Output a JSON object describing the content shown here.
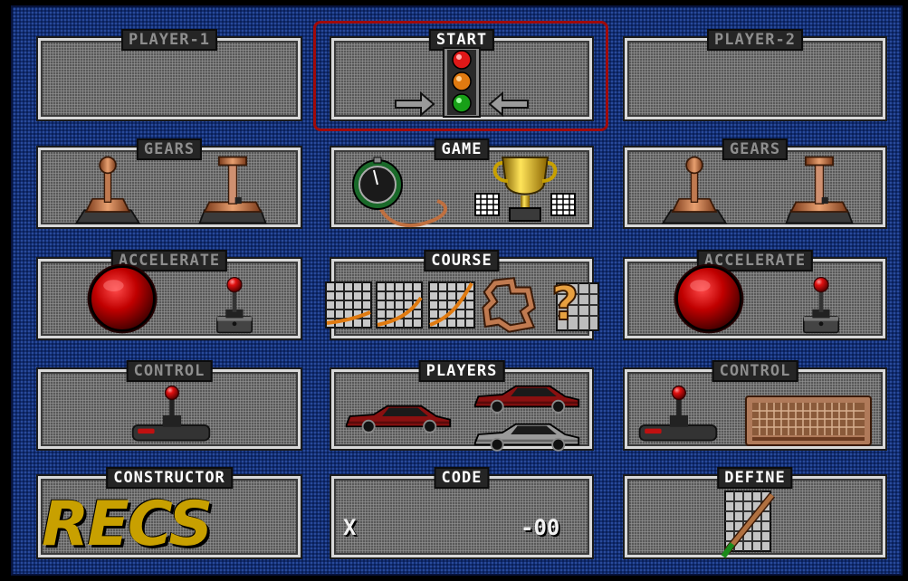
{
  "panels": {
    "player1": {
      "title": "PLAYER-1"
    },
    "start": {
      "title": "START"
    },
    "player2": {
      "title": "PLAYER-2"
    },
    "gears_l": {
      "title": "GEARS"
    },
    "game": {
      "title": "GAME"
    },
    "gears_r": {
      "title": "GEARS"
    },
    "accel_l": {
      "title": "ACCELERATE"
    },
    "course": {
      "title": "COURSE"
    },
    "accel_r": {
      "title": "ACCELERATE"
    },
    "control_l": {
      "title": "CONTROL"
    },
    "players": {
      "title": "PLAYERS"
    },
    "control_r": {
      "title": "CONTROL"
    },
    "constructor": {
      "title": "CONSTRUCTOR",
      "logo_text": "RECS"
    },
    "code": {
      "title": "CODE",
      "prefix": "X",
      "value": "-00"
    },
    "define": {
      "title": "DEFINE"
    }
  },
  "icons": {
    "traffic_light": "traffic-light-icon",
    "stopwatch": "stopwatch-icon",
    "trophy": "trophy-icon",
    "gear_lever": "gear-lever-icon",
    "red_button": "red-button-icon",
    "joystick": "joystick-icon",
    "keyboard": "keyboard-icon",
    "track_graph": "track-graph-icon",
    "track_map": "track-map-icon",
    "question": "question-mark-icon",
    "car": "car-icon",
    "grid_pencil": "grid-pencil-icon"
  },
  "colors": {
    "background": "#122e72",
    "panel": "#6f6f6f",
    "selection": "#a00a0a",
    "title_active": "#ffffff",
    "title_dim": "#8e8e8e",
    "logo": "#c8a000"
  }
}
